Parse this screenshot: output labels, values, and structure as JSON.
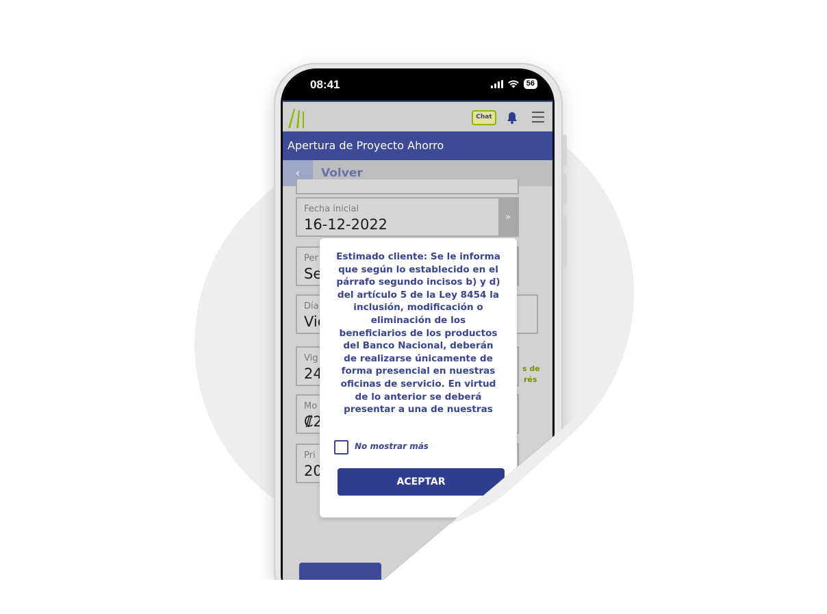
{
  "status_bar": {
    "time": "08:41",
    "battery": "56"
  },
  "header": {
    "chat_label": "Chat"
  },
  "page": {
    "title": "Apertura de Proyecto Ahorro",
    "back_label": "Volver"
  },
  "fields": [
    {
      "label": "Fecha inicial",
      "value": "16-12-2022"
    },
    {
      "label": "Per",
      "value": "Se"
    },
    {
      "label": "Día",
      "value": "Vie"
    },
    {
      "label": "Vig",
      "value": "24"
    },
    {
      "label": "Mo",
      "value": "₡2"
    },
    {
      "label": "Pri",
      "value": "20"
    }
  ],
  "side_labels": {
    "line1": "s de",
    "line2": "rés"
  },
  "modal": {
    "message": "Estimado cliente: Se le informa que según lo establecido en el párrafo segundo incisos b) y d) del artículo 5 de la Ley 8454 la inclusión, modificación o eliminación de los beneficiarios de los productos del Banco Nacional, deberán de realizarse únicamente de forma presencial en nuestras oficinas de servicio. En virtud de lo anterior se deberá presentar a una de nuestras",
    "checkbox_label": "No mostrar más",
    "accept_label": "ACEPTAR"
  }
}
